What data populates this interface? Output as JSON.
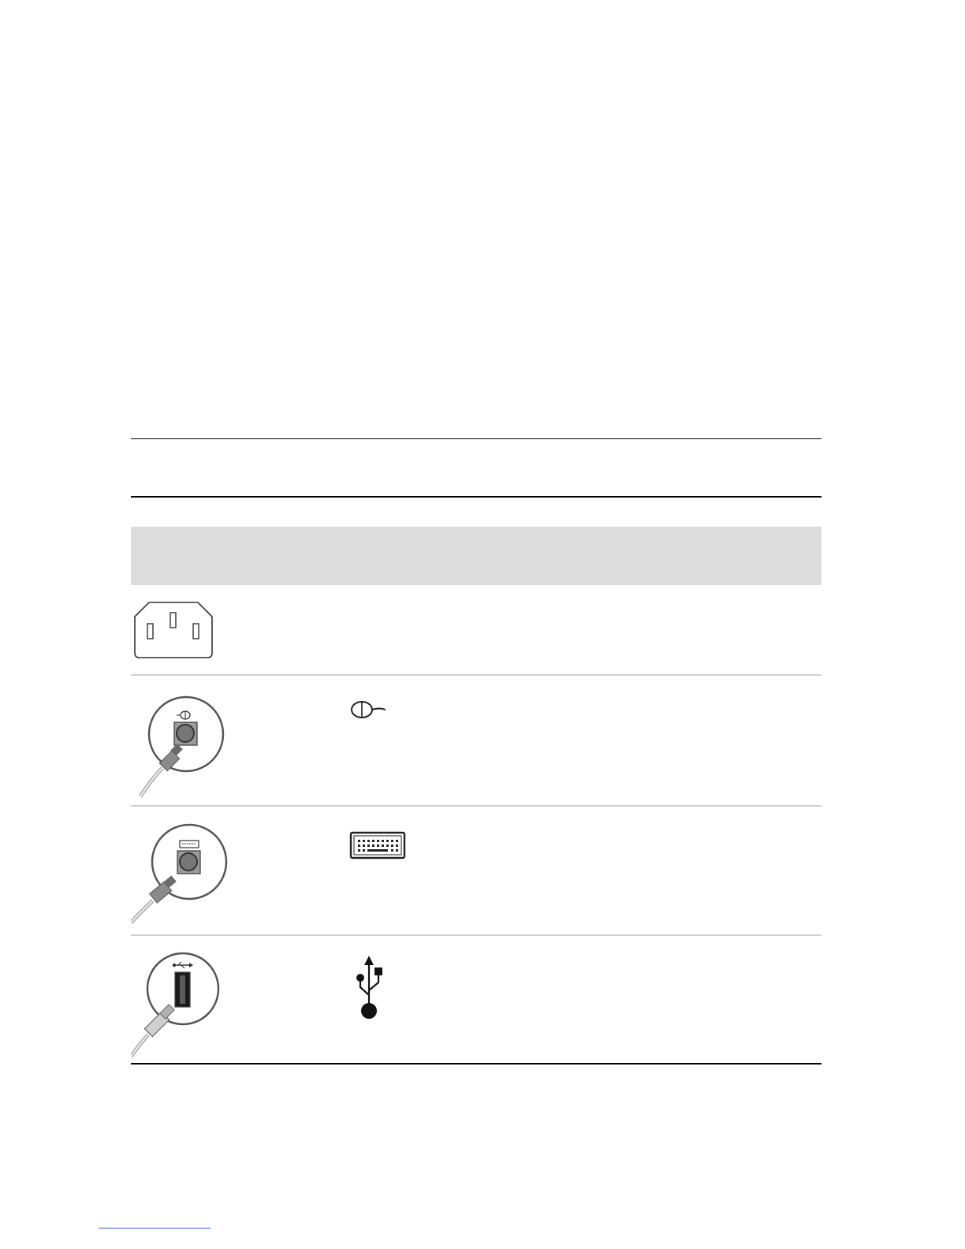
{
  "page": {
    "background": "#ffffff",
    "rule_color": "#000000",
    "table_header_color": "#dcdcdc",
    "row_separator_color": "#d0d0d0",
    "link_underline_color": "#3b5bdb"
  },
  "connector_table": {
    "rows": [
      {
        "connector_icon": "power-socket-icon",
        "symbol_icon": ""
      },
      {
        "connector_icon": "ps2-mouse-port-icon",
        "symbol_icon": "mouse-icon"
      },
      {
        "connector_icon": "ps2-keyboard-port-icon",
        "symbol_icon": "keyboard-icon"
      },
      {
        "connector_icon": "usb-port-icon",
        "symbol_icon": "usb-icon"
      }
    ]
  }
}
